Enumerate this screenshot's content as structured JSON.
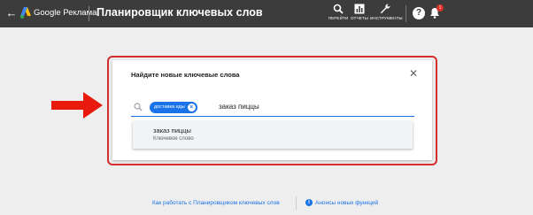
{
  "header": {
    "brand": "Google Реклама",
    "title": "Планировщик ключевых слов",
    "tools": [
      {
        "label": "Перейти",
        "icon": "search-icon"
      },
      {
        "label": "Отчеты",
        "icon": "reports-icon"
      },
      {
        "label": "Инструменты",
        "icon": "wrench-icon"
      }
    ],
    "help": "?",
    "notifications_count": "1"
  },
  "dialog": {
    "title": "Найдите новые ключевые слова",
    "chip_label": "доставка еды",
    "query_text": "заказ пиццы",
    "suggestion": {
      "title": "заказ пиццы",
      "subtitle": "Ключевое слово"
    }
  },
  "footer": {
    "link_howto": "Как работать с Планировщиком ключевых слов",
    "link_news": "Анонсы новых функций"
  },
  "colors": {
    "topbar": "#3c3c3c",
    "accent": "#1a73e8",
    "highlight": "#d32f2f",
    "background": "#eeeeee"
  }
}
